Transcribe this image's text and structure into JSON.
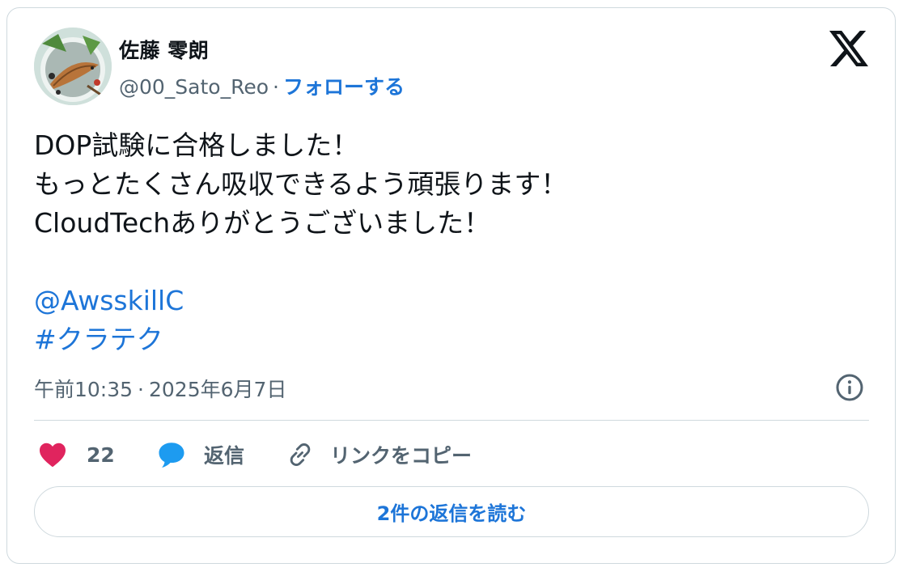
{
  "user": {
    "display_name": "佐藤 零朗",
    "handle": "@00_Sato_Reo",
    "separator": "·",
    "follow_label": "フォローする"
  },
  "tweet": {
    "lines": [
      "DOP試験に合格しました！",
      "もっとたくさん吸収できるよう頑張ります！",
      "CloudTechありがとうございました！"
    ],
    "mention": "@AwsskillC",
    "hashtag": "#クラテク"
  },
  "meta": {
    "time": "午前10:35",
    "separator": "·",
    "date": "2025年6月7日"
  },
  "actions": {
    "like_count": "22",
    "reply_label": "返信",
    "copy_link_label": "リンクをコピー"
  },
  "read_replies_label": "2件の返信を読む",
  "icons": {
    "brand": "x-logo-icon",
    "like": "heart-icon",
    "reply": "speech-bubble-icon",
    "copy": "link-icon",
    "info": "info-icon"
  },
  "colors": {
    "link": "#1d75d8",
    "heart": "#f91880",
    "reply": "#1d9bf0",
    "text": "#0f1419",
    "muted": "#536471",
    "border": "#cfd9de"
  }
}
